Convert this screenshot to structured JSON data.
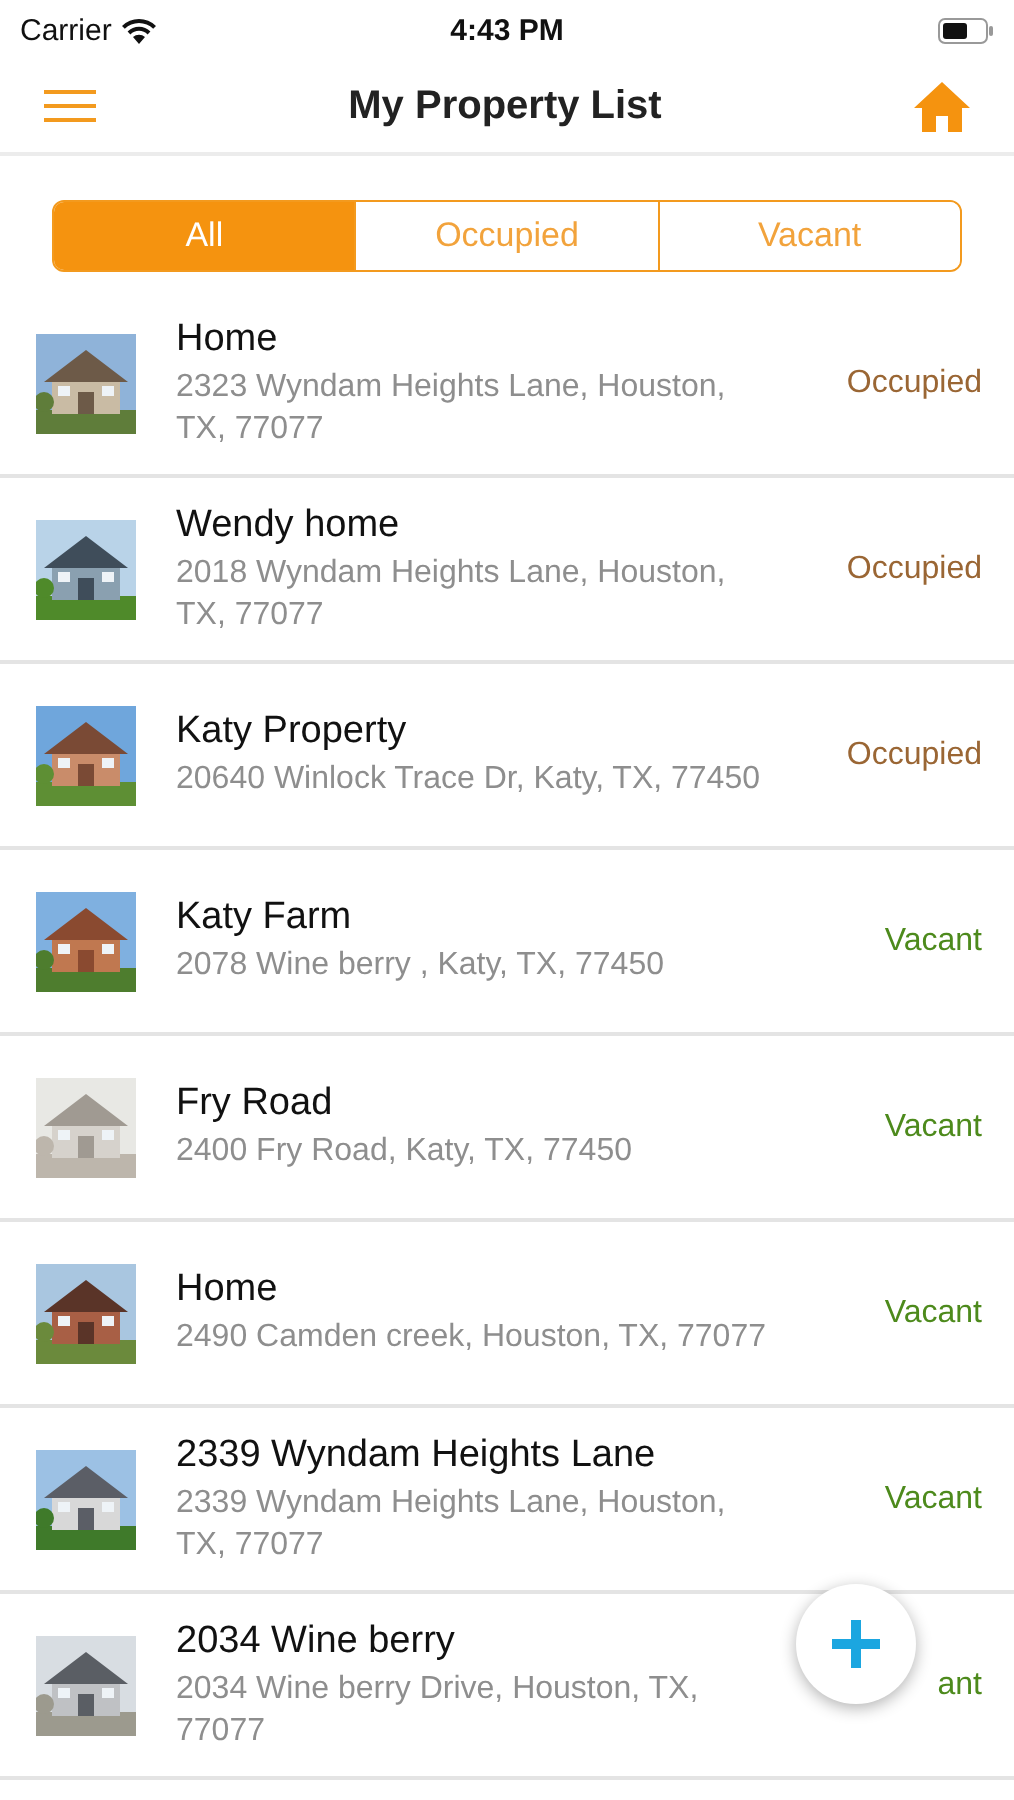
{
  "status_bar": {
    "carrier": "Carrier",
    "time": "4:43 PM"
  },
  "nav": {
    "title": "My Property List"
  },
  "tabs": [
    {
      "label": "All",
      "selected": true
    },
    {
      "label": "Occupied",
      "selected": false
    },
    {
      "label": "Vacant",
      "selected": false
    }
  ],
  "properties": [
    {
      "name": "Home",
      "address": "2323 Wyndam Heights Lane, Houston, TX, 77077",
      "status": "Occupied",
      "color": "#9a6634"
    },
    {
      "name": "Wendy home",
      "address": "2018 Wyndam Heights Lane, Houston, TX, 77077",
      "status": "Occupied",
      "color": "#9a6634"
    },
    {
      "name": "Katy Property",
      "address": "20640 Winlock Trace Dr, Katy, TX, 77450",
      "status": "Occupied",
      "color": "#9a6634"
    },
    {
      "name": "Katy Farm",
      "address": "2078 Wine berry , Katy, TX, 77450",
      "status": "Vacant",
      "color": "#4d8a1c"
    },
    {
      "name": "Fry Road",
      "address": "2400 Fry Road, Katy, TX, 77450",
      "status": "Vacant",
      "color": "#4d8a1c"
    },
    {
      "name": "Home",
      "address": "2490 Camden creek, Houston, TX, 77077",
      "status": "Vacant",
      "color": "#4d8a1c"
    },
    {
      "name": "2339 Wyndam Heights Lane",
      "address": "2339 Wyndam Heights Lane, Houston, TX, 77077",
      "status": "Vacant",
      "color": "#4d8a1c"
    },
    {
      "name": "2034 Wine berry",
      "address": "2034 Wine berry Drive, Houston, TX, 77077",
      "status": "ant",
      "color": "#4d8a1c"
    }
  ]
}
